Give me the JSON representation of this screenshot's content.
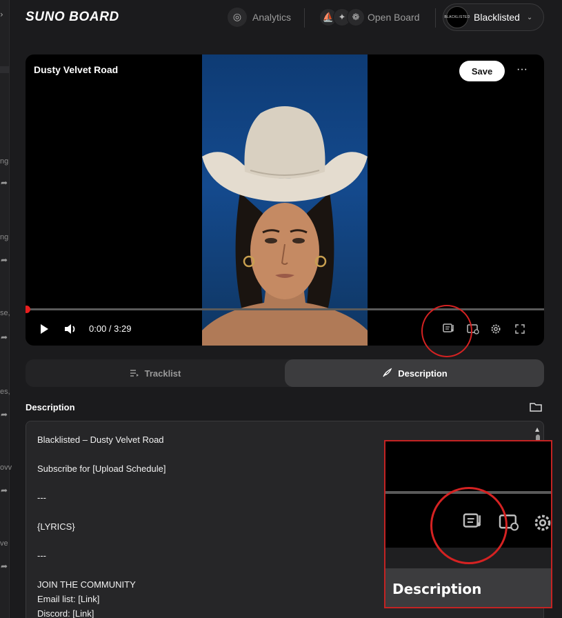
{
  "app": {
    "brand": "SUNO BOARD"
  },
  "nav": {
    "analytics_label": "Analytics",
    "open_board_label": "Open Board",
    "user_name": "Blacklisted",
    "avatar_text": "BLACKLISTED"
  },
  "player": {
    "title": "Dusty Velvet Road",
    "save_label": "Save",
    "more_label": "···",
    "time": "0:00 / 3:29",
    "progress": 0
  },
  "tabs": {
    "tracklist_label": "Tracklist",
    "description_label": "Description",
    "active": "Description"
  },
  "description": {
    "label": "Description",
    "lines": [
      "Blacklisted – Dusty Velvet Road",
      "",
      "Subscribe for [Upload Schedule]",
      "",
      "---",
      "",
      "{LYRICS}",
      "",
      "---",
      "",
      "JOIN THE COMMUNITY",
      "Email list: [Link]",
      "Discord: [Link]"
    ]
  },
  "inset": {
    "label": "Description"
  },
  "background_fragments": [
    "ng",
    "ng",
    "se,",
    "es,",
    "ovv",
    "ve"
  ],
  "colors": {
    "accent_red": "#e81e1e",
    "annotation_red": "#d52222",
    "background": "#1b1b1d"
  }
}
